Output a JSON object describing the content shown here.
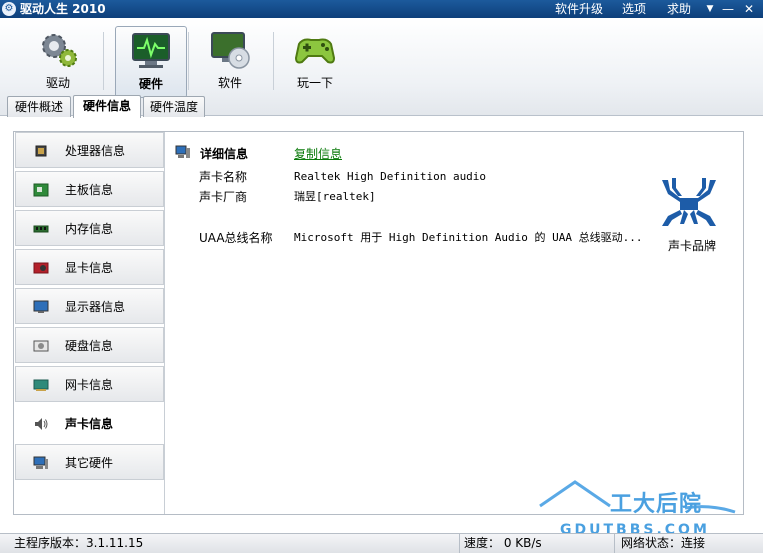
{
  "window": {
    "title": "驱动人生 2010",
    "menu": [
      "软件升级",
      "选项",
      "求助"
    ],
    "controls": {
      "menu_arrow": "▼",
      "minimize": "—",
      "close": "✕"
    }
  },
  "toolbar": {
    "items": [
      {
        "label": "驱动",
        "icon": "gears-icon"
      },
      {
        "label": "硬件",
        "icon": "monitor-pulse-icon",
        "active": true
      },
      {
        "label": "软件",
        "icon": "monitor-disc-icon"
      },
      {
        "label": "玩一下",
        "icon": "gamepad-icon"
      }
    ]
  },
  "tabs": [
    {
      "label": "硬件概述"
    },
    {
      "label": "硬件信息",
      "active": true
    },
    {
      "label": "硬件温度"
    }
  ],
  "sidebar": {
    "items": [
      {
        "label": "处理器信息",
        "icon": "cpu-icon"
      },
      {
        "label": "主板信息",
        "icon": "motherboard-icon"
      },
      {
        "label": "内存信息",
        "icon": "memory-icon"
      },
      {
        "label": "显卡信息",
        "icon": "graphics-card-icon"
      },
      {
        "label": "显示器信息",
        "icon": "monitor-icon"
      },
      {
        "label": "硬盘信息",
        "icon": "hard-disk-icon"
      },
      {
        "label": "网卡信息",
        "icon": "network-card-icon"
      },
      {
        "label": "声卡信息",
        "icon": "speaker-icon",
        "active": true
      },
      {
        "label": "其它硬件",
        "icon": "computer-icon"
      }
    ]
  },
  "detail": {
    "title": "详细信息",
    "copy_label": "复制信息",
    "rows": [
      {
        "label": "声卡名称",
        "value": "Realtek High Definition audio"
      },
      {
        "label": "声卡厂商",
        "value": "瑞昱[realtek]"
      },
      {
        "label": "UAA总线名称",
        "value": "Microsoft 用于 High Definition Audio 的 UAA 总线驱动..."
      }
    ],
    "brand_label": "声卡品牌"
  },
  "statusbar": {
    "version": "主程序版本：3.1.11.15",
    "speed": "速度： 0 KB/s",
    "network": "网络状态：连接"
  },
  "watermark": {
    "text": "工大后院",
    "sub": "GDUTBBS.COM"
  },
  "colors": {
    "accent": "#1c5a9c",
    "link": "#0a7a0a",
    "brand_blue": "#1d5ca8"
  }
}
